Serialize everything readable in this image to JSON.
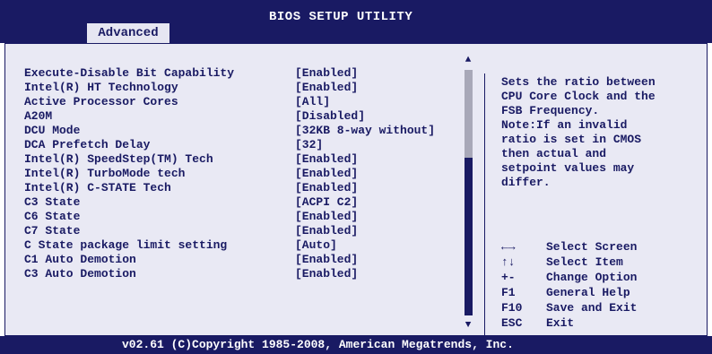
{
  "header": {
    "title": "BIOS SETUP UTILITY",
    "tab_label": "Advanced"
  },
  "settings": [
    {
      "label": "Execute-Disable Bit Capability",
      "value": "[Enabled]"
    },
    {
      "label": "Intel(R) HT Technology",
      "value": "[Enabled]"
    },
    {
      "label": "Active Processor Cores",
      "value": "[All]"
    },
    {
      "label": "A20M",
      "value": "[Disabled]"
    },
    {
      "label": "DCU Mode",
      "value": "[32KB 8-way without]"
    },
    {
      "label": "DCA Prefetch Delay",
      "value": "[32]"
    },
    {
      "label": "Intel(R) SpeedStep(TM) Tech",
      "value": "[Enabled]"
    },
    {
      "label": "Intel(R) TurboMode tech",
      "value": "[Enabled]"
    },
    {
      "label": "Intel(R) C-STATE Tech",
      "value": "[Enabled]"
    },
    {
      "label": "C3 State",
      "value": "[ACPI C2]"
    },
    {
      "label": "C6 State",
      "value": "[Enabled]"
    },
    {
      "label": "C7 State",
      "value": "[Enabled]"
    },
    {
      "label": "C State package limit setting",
      "value": "[Auto]"
    },
    {
      "label": "C1 Auto Demotion",
      "value": "[Enabled]"
    },
    {
      "label": "C3 Auto Demotion",
      "value": "[Enabled]"
    }
  ],
  "help": {
    "lines": [
      "Sets the ratio between",
      "CPU Core Clock and the",
      "FSB Frequency.",
      "Note:If an invalid",
      "ratio is set in CMOS",
      "then actual and",
      "setpoint values may",
      "differ."
    ]
  },
  "keys": [
    {
      "key": "←→",
      "action": "Select Screen"
    },
    {
      "key": "↑↓",
      "action": "Select Item"
    },
    {
      "key": "+-",
      "action": "Change Option"
    },
    {
      "key": "F1",
      "action": "General Help"
    },
    {
      "key": "F10",
      "action": "Save and Exit"
    },
    {
      "key": "ESC",
      "action": "Exit"
    }
  ],
  "footer": {
    "copyright": "v02.61 (C)Copyright 1985-2008, American Megatrends, Inc."
  },
  "icons": {
    "scroll_up": "up-arrow-icon",
    "scroll_down": "down-arrow-icon"
  },
  "colors": {
    "bar": "#191a63",
    "panel": "#e9e9f4",
    "text": "#191a63",
    "scroll_thumb": "#a8a8b8"
  }
}
